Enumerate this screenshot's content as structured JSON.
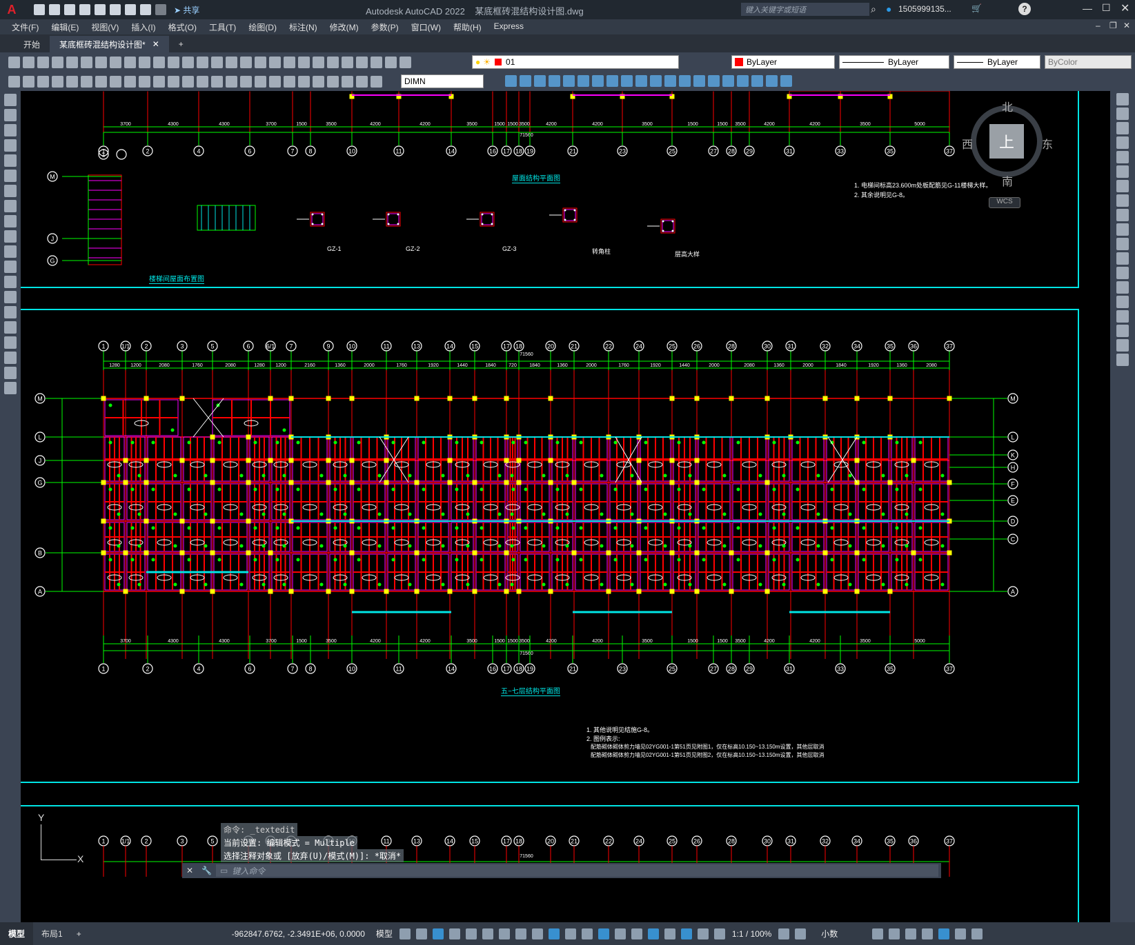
{
  "app": {
    "title": "Autodesk AutoCAD 2022",
    "document": "某底框砖混结构设计图.dwg",
    "share_label": "共享",
    "search_placeholder": "键入关键字或短语",
    "user": "1505999135...",
    "logo": "A"
  },
  "menu": [
    "文件(F)",
    "编辑(E)",
    "视图(V)",
    "插入(I)",
    "格式(O)",
    "工具(T)",
    "绘图(D)",
    "标注(N)",
    "修改(M)",
    "参数(P)",
    "窗口(W)",
    "帮助(H)",
    "Express"
  ],
  "tabs": [
    "开始",
    "某底框砖混结构设计图*",
    "+"
  ],
  "toolbar": {
    "layer_value": "01",
    "color_value": "ByLayer",
    "linetype_value": "ByLayer",
    "lineweight_value": "ByLayer",
    "plotstyle_value": "ByColor",
    "dimstyle_value": "DIMN"
  },
  "viewcube": {
    "north": "北",
    "south": "南",
    "east": "东",
    "west": "西",
    "top": "上",
    "wcs": "WCS"
  },
  "drawing": {
    "dims_top_a": [
      "3700",
      "4300",
      "4300",
      "3700",
      "1500",
      "3500",
      "4200",
      "4200",
      "3500",
      "1500",
      "1500",
      "3500",
      "4200",
      "4200",
      "3500",
      "1500",
      "1500",
      "3500",
      "4200",
      "4200",
      "3500",
      "5000"
    ],
    "axes_row1": [
      "1",
      "2",
      "4",
      "6",
      "7",
      "8",
      "10",
      "11",
      "14",
      "16",
      "17",
      "18",
      "19",
      "21",
      "23",
      "25",
      "27",
      "28",
      "29",
      "31",
      "33",
      "35",
      "37"
    ],
    "axes_row2": [
      "1",
      "1/1",
      "2",
      "3",
      "5",
      "6",
      "6/1",
      "7",
      "9",
      "10",
      "11",
      "13",
      "14",
      "15",
      "17",
      "18",
      "20",
      "21",
      "22",
      "24",
      "25",
      "26",
      "28",
      "30",
      "31",
      "32",
      "34",
      "35",
      "36",
      "37"
    ],
    "total_dim": "71560",
    "roof_title": "屋面结构平面图",
    "stair_title": "楼梯间屋面布置图",
    "floor_title": "五~七层结构平面图",
    "notes_roof": [
      "1. 电梯间标高23.600m处板配筋见G-11楼梯大样。",
      "2. 其余说明见G-8。"
    ],
    "notes_floor": [
      "1. 其他说明见结施G-8。",
      "2. 图例表示:",
      "配筋砌体砌体剪力墙见02YG001-1第51页见附图1，仅在标高10.150~13.150m设置，其他层取消",
      "配筋砌体砌体剪力墙见02YG001-1第51页见附图2，仅在标高10.150~13.150m设置，其他层取消"
    ],
    "column_labels": [
      "GZ-1",
      "GZ-2",
      "GZ-3",
      "转角柱",
      "层高大样"
    ],
    "left_axes": [
      "M",
      "L",
      "J",
      "G",
      "B",
      "A"
    ],
    "right_axes": [
      "M",
      "L",
      "K",
      "H",
      "F",
      "E",
      "D",
      "C",
      "A"
    ]
  },
  "command": {
    "lines": [
      "命令: _textedit",
      "当前设置: 编辑模式 = Multiple",
      "选择注释对象或 [放弃(U)/模式(M)]: *取消*"
    ],
    "prompt": "键入命令"
  },
  "status": {
    "model_tab": "模型",
    "layout_tab": "布局1",
    "add_tab": "+",
    "coords": "-962847.6762, -2.3491E+06, 0.0000",
    "model_label": "模型",
    "scale": "1:1 / 100%",
    "units": "小数"
  },
  "ucs": {
    "y": "Y",
    "x": "X"
  },
  "colors": {
    "accent": "#00e5e5",
    "axis_green": "#00ff00",
    "wall_red": "#ff0000",
    "column_yellow": "#ffff00",
    "beam_magenta": "#ff00ff"
  }
}
